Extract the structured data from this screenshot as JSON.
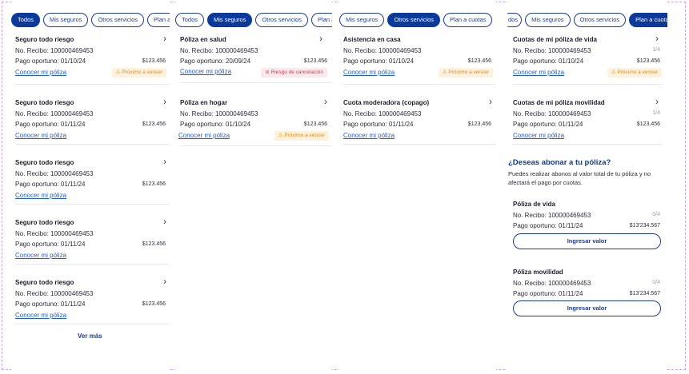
{
  "screen1": {
    "tabs": [
      "Todos",
      "Mis seguros",
      "Otros servicios",
      "Plan a cuotas"
    ],
    "active_tab": 0,
    "cards": [
      {
        "title": "Seguro todo riesgo",
        "recibo": "No. Recibo: 100000469453",
        "pago": "Pago oportuno: 01/10/24",
        "amount": "$123.456",
        "link": "Conocer mi póliza",
        "badge": "Próximo a vencer"
      },
      {
        "title": "Seguro todo riesgo",
        "recibo": "No. Recibo: 100000469453",
        "pago": "Pago oportuno: 01/11/24",
        "amount": "$123.456",
        "link": "Conocer mi póliza"
      },
      {
        "title": "Seguro todo riesgo",
        "recibo": "No. Recibo: 100000469453",
        "pago": "Pago oportuno: 01/11/24",
        "amount": "$123.456",
        "link": "Conocer mi póliza"
      },
      {
        "title": "Seguro todo riesgo",
        "recibo": "No. Recibo: 100000469453",
        "pago": "Pago oportuno: 01/11/24",
        "amount": "$123.456",
        "link": "Conocer mi póliza"
      },
      {
        "title": "Seguro todo riesgo",
        "recibo": "No. Recibo: 100000469453",
        "pago": "Pago oportuno: 01/11/24",
        "amount": "$123.456",
        "link": "Conocer mi póliza"
      }
    ],
    "ver_mas": "Ver más"
  },
  "screen2": {
    "tabs": [
      "Todos",
      "Mis seguros",
      "Otros servicios",
      "Plan a cuotas"
    ],
    "active_tab": 1,
    "cards": [
      {
        "title": "Póliza en salud",
        "recibo": "No. Recibo: 100000469453",
        "pago": "Pago oportuno: 20/09/24",
        "amount": "$123.456",
        "link": "Conocer mi póliza",
        "badge": "Riesgo de cancelación",
        "badge_type": "risk"
      },
      {
        "title": "Póliza en hogar",
        "recibo": "No. Recibo: 100000469453",
        "pago": "Pago oportuno: 01/10/24",
        "amount": "$123.456",
        "link": "Conocer mi póliza",
        "badge": "Próximo a vencer",
        "badge_type": "warn"
      }
    ]
  },
  "screen3": {
    "tabs": [
      "Mis seguros",
      "Otros servicios",
      "Plan a cuotas"
    ],
    "active_tab": 1,
    "cards": [
      {
        "title": "Asistencia en casa",
        "recibo": "No. Recibo: 100000469453",
        "pago": "Pago oportuno: 01/10/24",
        "amount": "$123.456",
        "link": "Conocer mi póliza",
        "badge": "Próximo a vencer"
      },
      {
        "title": "Cuota moderadora (copago)",
        "recibo": "No. Recibo: 100000469453",
        "pago": "Pago oportuno: 01/11/24",
        "amount": "$123.456",
        "link": "Conocer mi póliza"
      }
    ]
  },
  "screen4": {
    "tabs": [
      "dos",
      "Mis seguros",
      "Otros servicios",
      "Plan a cuotas"
    ],
    "active_tab": 3,
    "cards": [
      {
        "title": "Cuotas de mi póliza de vida",
        "recibo": "No. Recibo: 100000469453",
        "cuota": "1/4",
        "pago": "Pago oportuno: 01/10/24",
        "amount": "$123.456",
        "link": "Conocer mi póliza",
        "badge": "Próximo a vencer"
      },
      {
        "title": "Cuotas de mi póliza movilidad",
        "recibo": "No. Recibo: 100000469453",
        "cuota": "1/4",
        "pago": "Pago oportuno: 01/11/24",
        "amount": "$123.456",
        "link": "Conocer mi póliza"
      }
    ],
    "abono_title": "¿Deseas abonar a tu póliza?",
    "abono_desc": "Puedes realizar abonos al valor total de tu póliza y no afectará el pago por cuotas.",
    "abono_cards": [
      {
        "title": "Póliza de vida",
        "recibo": "No. Recibo: 100000469453",
        "cuota": "0/4",
        "pago": "Pago oportuno: 01/11/24",
        "amount": "$13'234.567",
        "button": "Ingresar valor"
      },
      {
        "title": "Póliza movilidad",
        "recibo": "No. Recibo: 100000469453",
        "cuota": "0/4",
        "pago": "Pago oportuno: 01/11/24",
        "amount": "$13'234.567",
        "button": "Ingresar valor"
      }
    ]
  },
  "icons": {
    "chevron": "chevron-right-icon",
    "warning": "warning-icon",
    "risk": "alert-icon"
  },
  "colors": {
    "primary": "#0a3a9a",
    "link": "#1d5fd1",
    "warn_bg": "#fff1dc",
    "warn_text": "#e08a12",
    "risk_bg": "#fde9ec",
    "risk_text": "#d33a4a"
  }
}
